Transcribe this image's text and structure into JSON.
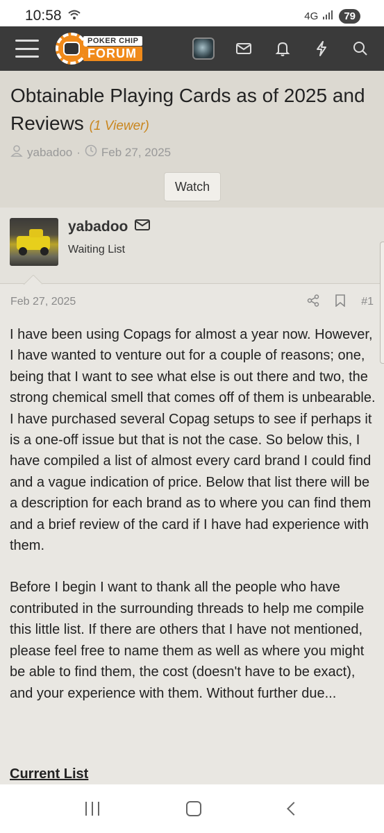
{
  "status_bar": {
    "time": "10:58",
    "network": "4G",
    "battery": "79"
  },
  "nav": {
    "logo_top": "POKER CHIP",
    "logo_bottom": "FORUM",
    "accent_color": "#f08a1a",
    "bar_color": "#3a3a3a",
    "icons": [
      "menu-icon",
      "avatar",
      "mail-icon",
      "bell-icon",
      "bolt-icon",
      "search-icon"
    ]
  },
  "thread": {
    "title": "Obtainable Playing Cards as of 2025 and Reviews",
    "viewers": "(1 Viewer)",
    "author": "yabadoo",
    "separator": "·",
    "date": "Feb 27, 2025",
    "watch_label": "Watch"
  },
  "post": {
    "username": "yabadoo",
    "user_title": "Waiting List",
    "date": "Feb 27, 2025",
    "number": "#1",
    "paragraphs": [
      "I have been using Copags for almost a year now. However, I have wanted to venture out for a couple of reasons; one, being that I want to see what else is out there and two, the strong chemical smell that comes off of them is unbearable. I have purchased several Copag setups to see if perhaps it is a one-off issue but that is not the case. So below this, I have compiled a list of almost every card brand I could find and a vague indication of price. Below that list there will be a description for each brand as to where you can find them and a brief review of the card if I have had experience with them.",
      "Before I begin I want to thank all the people who have contributed in the surrounding threads to help me compile this little list. If there are others that I have not mentioned, please feel free to name them as well as where you might be able to find them, the cost (doesn't have to be exact), and your experience with them. Without further due..."
    ],
    "section_heading": "Current List"
  }
}
